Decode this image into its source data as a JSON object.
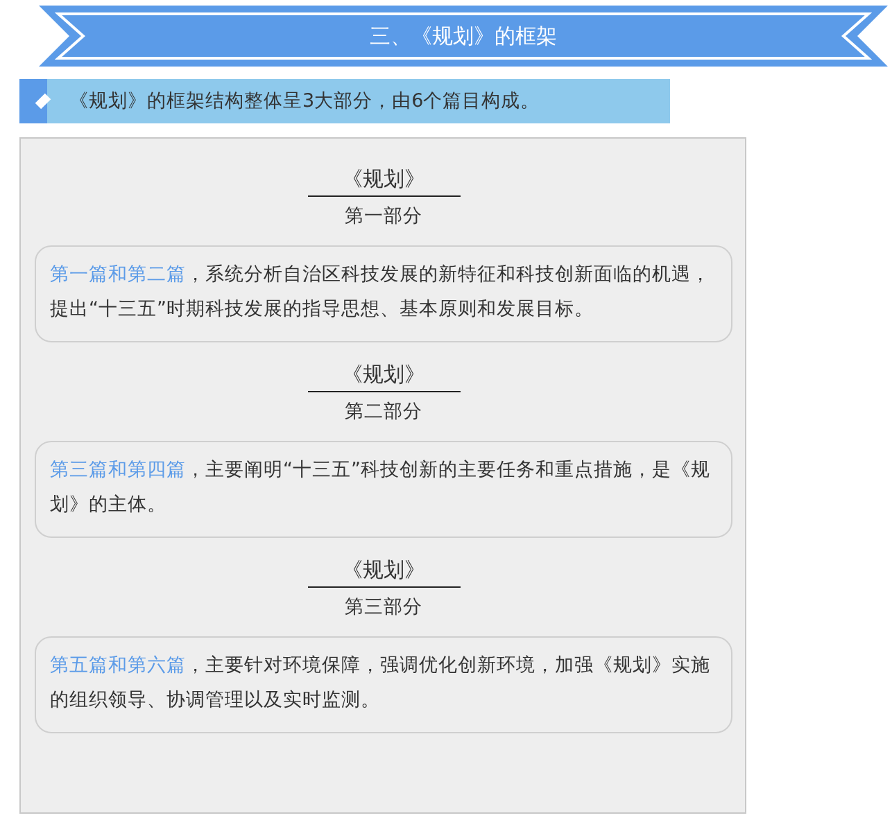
{
  "banner": {
    "title": "三、《规划》的框架"
  },
  "summary": "《规划》的框架结构整体呈3大部分，由6个篇目构成。",
  "sections": [
    {
      "title": "《规划》",
      "subtitle": "第一部分",
      "lead": "第一篇和第二篇",
      "text": "，系统分析自治区科技发展的新特征和科技创新面临的机遇，提出“十三五”时期科技发展的指导思想、基本原则和发展目标。"
    },
    {
      "title": "《规划》",
      "subtitle": "第二部分",
      "lead": "第三篇和第四篇",
      "text": "，主要阐明“十三五”科技创新的主要任务和重点措施，是《规划》的主体。"
    },
    {
      "title": "《规划》",
      "subtitle": "第三部分",
      "lead": "第五篇和第六篇",
      "text": "，主要针对环境保障，强调优化创新环境，加强《规划》实施的组织领导、协调管理以及实时监测。"
    }
  ]
}
